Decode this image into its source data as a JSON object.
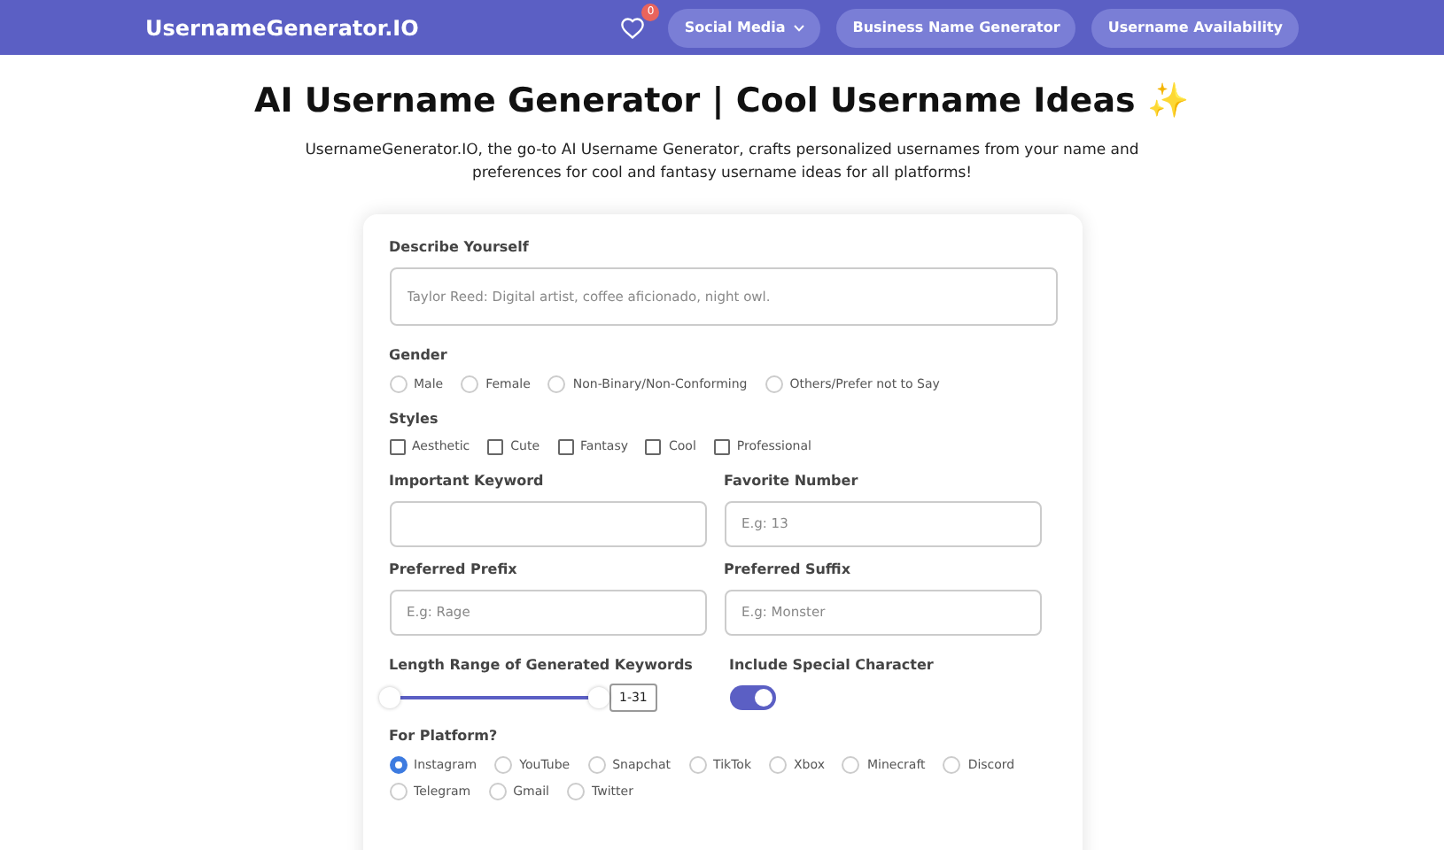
{
  "nav": {
    "brand": "UsernameGenerator.IO",
    "favorites_count": "0",
    "links": [
      {
        "label": "Social Media",
        "kind": "dropdown"
      },
      {
        "label": "Business Name Generator",
        "kind": "link"
      },
      {
        "label": "Username Availability",
        "kind": "link"
      }
    ]
  },
  "heading": {
    "title": "AI Username Generator | Cool Username Ideas ✨",
    "description": "UsernameGenerator.IO, the go-to AI Username Generator, crafts personalized usernames from your name and preferences for cool and fantasy username ideas for all platforms!"
  },
  "form": {
    "describe": {
      "label": "Describe Yourself",
      "placeholder": "Taylor Reed: Digital artist, coffee aficionado, night owl."
    },
    "gender": {
      "label": "Gender",
      "options": [
        {
          "label": "Male",
          "selected": false
        },
        {
          "label": "Female",
          "selected": false
        },
        {
          "label": "Non-Binary/Non-Conforming",
          "selected": false
        },
        {
          "label": "Others/Prefer not to Say",
          "selected": false
        }
      ]
    },
    "styles": {
      "label": "Styles",
      "options": [
        {
          "label": "Aesthetic",
          "checked": false
        },
        {
          "label": "Cute",
          "checked": false
        },
        {
          "label": "Fantasy",
          "checked": false
        },
        {
          "label": "Cool",
          "checked": false
        },
        {
          "label": "Professional",
          "checked": false
        }
      ]
    },
    "fields": [
      {
        "label": "Important Keyword"
      },
      {
        "label": "Favorite Number",
        "placeholder": "E.g: 13"
      },
      {
        "label": "Preferred Prefix",
        "placeholder": "E.g: Rage"
      },
      {
        "label": "Preferred Suffix",
        "placeholder": "E.g: Monster"
      }
    ],
    "length_range": {
      "label": "Length Range of Generated Keywords",
      "level": 1,
      "reading": "1-31"
    },
    "special_character": {
      "label": "Include Special Character",
      "on": true
    },
    "platform": {
      "label": "For Platform?",
      "options": [
        {
          "label": "Instagram",
          "selected": true
        },
        {
          "label": "YouTube",
          "selected": false
        },
        {
          "label": "Snapchat",
          "selected": false
        },
        {
          "label": "TikTok",
          "selected": false
        },
        {
          "label": "Xbox",
          "selected": false
        },
        {
          "label": "Minecraft",
          "selected": false
        },
        {
          "label": "Discord",
          "selected": false
        },
        {
          "label": "Telegram",
          "selected": false
        },
        {
          "label": "Gmail",
          "selected": false
        },
        {
          "label": "Twitter",
          "selected": false
        }
      ]
    }
  }
}
